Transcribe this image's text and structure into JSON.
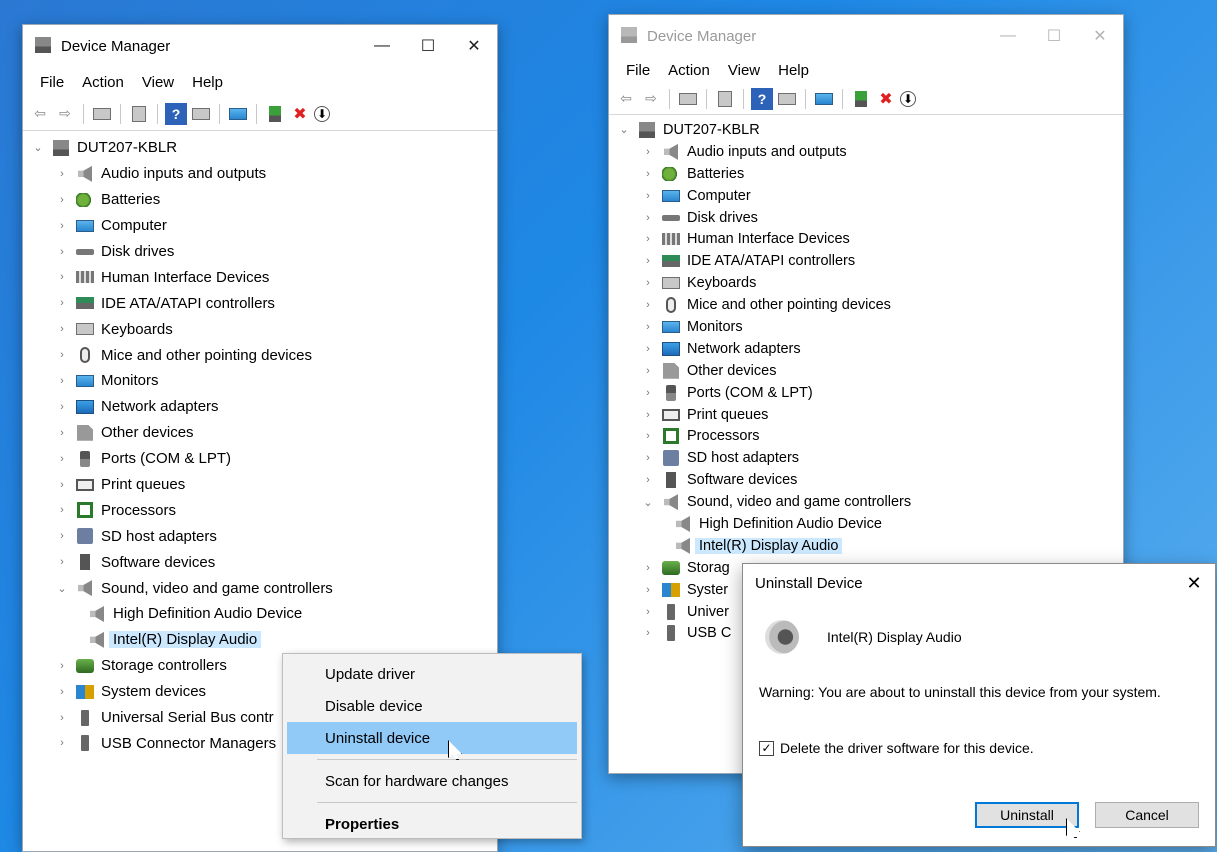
{
  "left_window": {
    "title": "Device Manager",
    "controls": [
      "—",
      "☐",
      "✕"
    ],
    "menu": [
      "File",
      "Action",
      "View",
      "Help"
    ],
    "root": "DUT207-KBLR",
    "items": [
      {
        "label": "Audio inputs and outputs",
        "icon": "speaker-icon"
      },
      {
        "label": "Batteries",
        "icon": "battery-icon"
      },
      {
        "label": "Computer",
        "icon": "monitor-icon"
      },
      {
        "label": "Disk drives",
        "icon": "disk-icon"
      },
      {
        "label": "Human Interface Devices",
        "icon": "hid-icon"
      },
      {
        "label": "IDE ATA/ATAPI controllers",
        "icon": "ide-icon"
      },
      {
        "label": "Keyboards",
        "icon": "keyboard-icon"
      },
      {
        "label": "Mice and other pointing devices",
        "icon": "mouse-icon"
      },
      {
        "label": "Monitors",
        "icon": "monitor-icon"
      },
      {
        "label": "Network adapters",
        "icon": "network-icon"
      },
      {
        "label": "Other devices",
        "icon": "other-device-icon"
      },
      {
        "label": "Ports (COM & LPT)",
        "icon": "port-icon"
      },
      {
        "label": "Print queues",
        "icon": "printer-icon"
      },
      {
        "label": "Processors",
        "icon": "processor-icon"
      },
      {
        "label": "SD host adapters",
        "icon": "sd-icon"
      },
      {
        "label": "Software devices",
        "icon": "software-icon"
      },
      {
        "label": "Sound, video and game controllers",
        "icon": "speaker-icon"
      },
      {
        "label": "High Definition Audio Device",
        "icon": "speaker-icon"
      },
      {
        "label": "Intel(R) Display Audio",
        "icon": "speaker-icon"
      },
      {
        "label": "Storage controllers",
        "icon": "storage-icon"
      },
      {
        "label": "System devices",
        "icon": "system-icon"
      },
      {
        "label": "Universal Serial Bus contr",
        "icon": "usb-icon"
      },
      {
        "label": "USB Connector Managers",
        "icon": "usb-icon"
      }
    ]
  },
  "context_menu": {
    "items": [
      "Update driver",
      "Disable device",
      "Uninstall device",
      "Scan for hardware changes",
      "Properties"
    ]
  },
  "right_window": {
    "title": "Device Manager",
    "controls": [
      "—",
      "☐",
      "✕"
    ],
    "menu": [
      "File",
      "Action",
      "View",
      "Help"
    ],
    "root": "DUT207-KBLR",
    "items": [
      {
        "label": "Audio inputs and outputs"
      },
      {
        "label": "Batteries"
      },
      {
        "label": "Computer"
      },
      {
        "label": "Disk drives"
      },
      {
        "label": "Human Interface Devices"
      },
      {
        "label": "IDE ATA/ATAPI controllers"
      },
      {
        "label": "Keyboards"
      },
      {
        "label": "Mice and other pointing devices"
      },
      {
        "label": "Monitors"
      },
      {
        "label": "Network adapters"
      },
      {
        "label": "Other devices"
      },
      {
        "label": "Ports (COM & LPT)"
      },
      {
        "label": "Print queues"
      },
      {
        "label": "Processors"
      },
      {
        "label": "SD host adapters"
      },
      {
        "label": "Software devices"
      },
      {
        "label": "Sound, video and game controllers"
      },
      {
        "label": "High Definition Audio Device"
      },
      {
        "label": "Intel(R) Display Audio"
      },
      {
        "label": "Storag"
      },
      {
        "label": "Syster"
      },
      {
        "label": "Univer"
      },
      {
        "label": "USB C"
      }
    ]
  },
  "dialog": {
    "title": "Uninstall Device",
    "close": "✕",
    "device_name": "Intel(R) Display Audio",
    "warning": "Warning: You are about to uninstall this device from your system.",
    "checkbox_label": "Delete the driver software for this device.",
    "checkbox_mark": "✓",
    "uninstall_label": "Uninstall",
    "cancel_label": "Cancel"
  },
  "glyphs": {
    "expand": "›",
    "collapse": "⌄",
    "back": "⇦",
    "forward": "⇨",
    "help": "?",
    "remove": "✖",
    "download": "⬇"
  }
}
